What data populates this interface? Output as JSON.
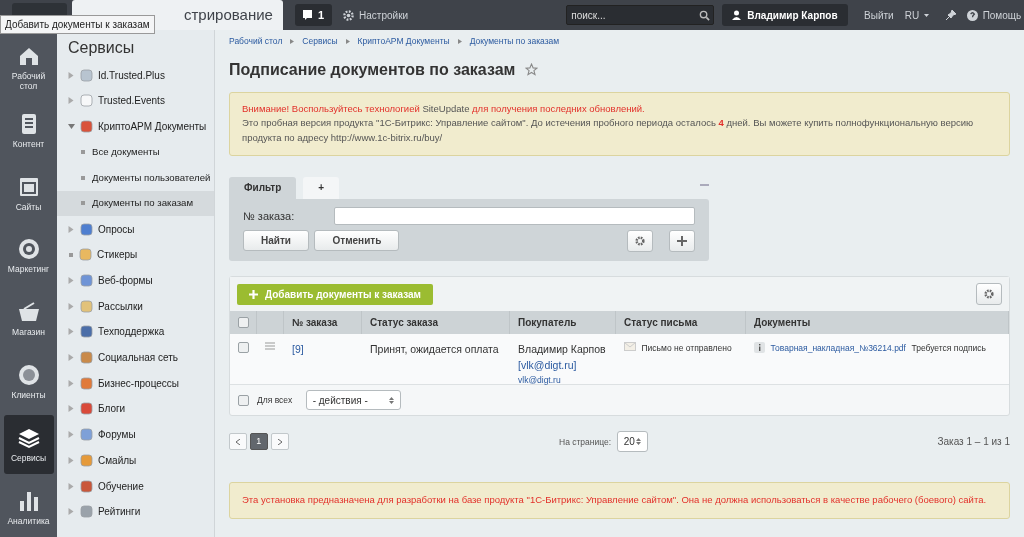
{
  "tooltip": {
    "text": "Добавить документы к заказам"
  },
  "top_bar": {
    "tab_label": "стрирование",
    "notifications": "1",
    "settings": "Настройки",
    "search": {
      "placeholder": "поиск..."
    },
    "user": "Владимир Карпов",
    "logout": "Выйти",
    "language": "RU",
    "help": "Помощь"
  },
  "left_nav": {
    "items": [
      {
        "label": "Рабочий стол",
        "selected": false
      },
      {
        "label": "Контент",
        "selected": false
      },
      {
        "label": "Сайты",
        "selected": false
      },
      {
        "label": "Маркетинг",
        "selected": false
      },
      {
        "label": "Магазин",
        "selected": false
      },
      {
        "label": "Клиенты",
        "selected": false
      },
      {
        "label": "Сервисы",
        "selected": true
      },
      {
        "label": "Аналитика",
        "selected": false
      }
    ]
  },
  "services": {
    "title": "Сервисы",
    "items": [
      {
        "label": "Id.Trusted.Plus",
        "kind": "folder",
        "expanded": false,
        "color": "#b8c4d0"
      },
      {
        "label": "Trusted.Events",
        "kind": "folder",
        "expanded": false,
        "color": "#f7f8f9"
      },
      {
        "label": "КриптоАРМ Документы",
        "kind": "folder",
        "expanded": true,
        "color": "#d9533b",
        "children": [
          {
            "label": "Все документы",
            "selected": false
          },
          {
            "label": "Документы пользователей",
            "selected": false
          },
          {
            "label": "Документы по заказам",
            "selected": true
          }
        ]
      },
      {
        "label": "Опросы",
        "kind": "folder",
        "expanded": false,
        "color": "#4f7fd0"
      },
      {
        "label": "Стикеры",
        "kind": "leaf",
        "color": "#e8b860"
      },
      {
        "label": "Веб-формы",
        "kind": "folder",
        "expanded": false,
        "color": "#6f94d6"
      },
      {
        "label": "Рассылки",
        "kind": "folder",
        "expanded": false,
        "color": "#e2c27a"
      },
      {
        "label": "Техподдержка",
        "kind": "folder",
        "expanded": false,
        "color": "#4b6ea8"
      },
      {
        "label": "Социальная сеть",
        "kind": "folder",
        "expanded": false,
        "color": "#c98a4a"
      },
      {
        "label": "Бизнес-процессы",
        "kind": "folder",
        "expanded": false,
        "color": "#e07a3a"
      },
      {
        "label": "Блоги",
        "kind": "folder",
        "expanded": false,
        "color": "#d94a3a"
      },
      {
        "label": "Форумы",
        "kind": "folder",
        "expanded": false,
        "color": "#7ea0d8"
      },
      {
        "label": "Смайлы",
        "kind": "folder",
        "expanded": false,
        "color": "#e59a3a"
      },
      {
        "label": "Обучение",
        "kind": "folder",
        "expanded": false,
        "color": "#c9573a"
      },
      {
        "label": "Рейтинги",
        "kind": "folder",
        "expanded": false,
        "color": "#9aa2aa"
      }
    ]
  },
  "breadcrumbs": [
    "Рабочий стол",
    "Сервисы",
    "КриптоАРМ Документы",
    "Документы по заказам"
  ],
  "page_title": "Подписание документов по заказам",
  "warning": {
    "line1_before": "Внимание! Воспользуйтесь технологией",
    "line1_link": "SiteUpdate",
    "line1_after": "для получения последних обновлений.",
    "line2": "Это пробная версия продукта \"1С-Битрикс: Управление сайтом\". До истечения пробного периода осталось **4** дней. Вы можете купить полнофункциональную версию продукта по адресу",
    "line2_link": "http://www.1c-bitrix.ru/buy/"
  },
  "filter": {
    "tabs": [
      {
        "label": "Фильтр",
        "selected": true
      },
      {
        "label": "+",
        "selected": false
      }
    ],
    "field_label": "№ заказа:",
    "buttons": [
      "Найти",
      "Отменить"
    ]
  },
  "table": {
    "all_checked": false,
    "add_button": "Добавить документы к заказам",
    "columns": [
      "№ заказа",
      "Статус заказа",
      "Покупатель",
      "Статус письма",
      "Документы"
    ],
    "rows": [
      {
        "checked": false,
        "order": "[9]",
        "status": "Принят, ожидается оплата",
        "buyer": "Владимир Карпов",
        "buyer_login": "[vlk@digt.ru]",
        "buyer_email": "vlk@digt.ru",
        "mail_status": "Письмо не отправлено",
        "document": "Товарная_накладная_№36214.pdf",
        "document_status": "Требуется подпись"
      }
    ],
    "footer": {
      "checked": false,
      "label": "Для всех",
      "action": "- действия -"
    }
  },
  "pager": {
    "pages": [
      {
        "label": "1",
        "selected": true
      }
    ],
    "per_page_label": "На странице:",
    "per_page": "20",
    "summary": "Заказ 1 – 1 из 1"
  },
  "notice": "Эта установка предназначена для разработки на базе продукта \"1С-Битрикс: Управление сайтом\". Она не должна использоваться в качестве рабочего (боевого) сайта."
}
